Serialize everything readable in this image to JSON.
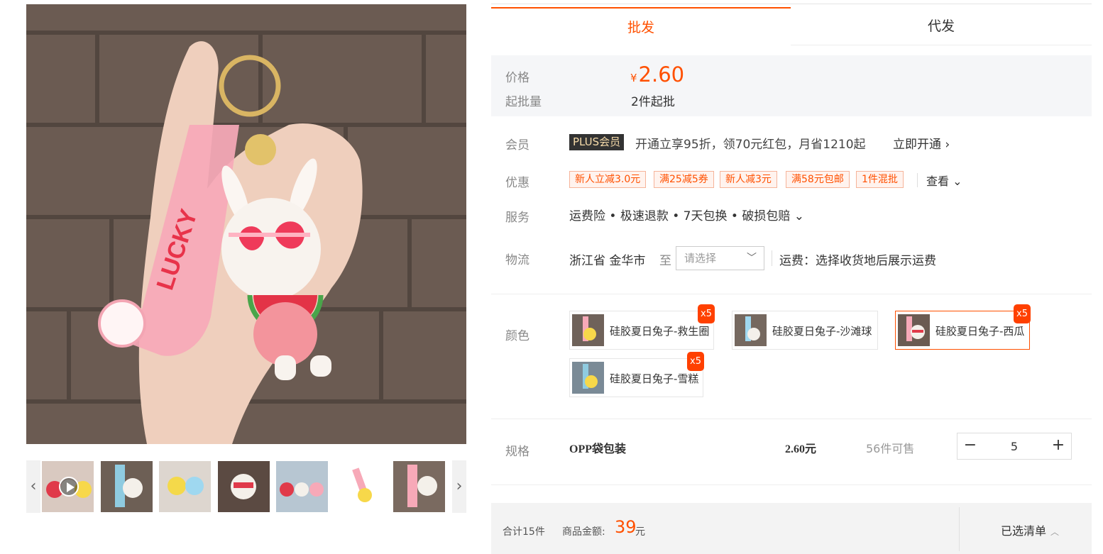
{
  "tabs": {
    "wholesale": "批发",
    "dropship": "代发"
  },
  "price": {
    "label": "价格",
    "currency": "¥",
    "value": "2.60",
    "moq_label": "起批量",
    "moq_value": "2件起批"
  },
  "member": {
    "label": "会员",
    "badge": "PLUS会员",
    "text": "开通立享95折，领70元红包，月省1210起",
    "link": "立即开通 ›"
  },
  "promo": {
    "label": "优惠",
    "coupons": [
      "新人立减3.0元",
      "满25减5券",
      "新人减3元",
      "满58元包邮",
      "1件混批"
    ],
    "view": "查看 ⌄"
  },
  "service": {
    "label": "服务",
    "text": "运费险 • 极速退款 • 7天包换 • 破损包赔 ⌄"
  },
  "logistics": {
    "label": "物流",
    "origin": "浙江省 金华市",
    "to": "至",
    "select_placeholder": "请选择",
    "fee": "运费：选择收货地后展示运费"
  },
  "color": {
    "label": "颜色",
    "options": [
      {
        "name": "硅胶夏日兔子-救生圈",
        "qty": "x5",
        "selected": false
      },
      {
        "name": "硅胶夏日兔子-沙滩球",
        "qty": "",
        "selected": false
      },
      {
        "name": "硅胶夏日兔子-西瓜",
        "qty": "x5",
        "selected": true
      },
      {
        "name": "硅胶夏日兔子-雪糕",
        "qty": "x5",
        "selected": false
      }
    ]
  },
  "spec": {
    "label": "规格",
    "name": "OPP袋包装",
    "price": "2.60元",
    "stock": "56件可售",
    "quantity": "5",
    "minus": "−",
    "plus": "+"
  },
  "summary": {
    "count": "合计15件",
    "amount_label": "商品金额:",
    "amount": "39",
    "unit": "元",
    "selected_list": "已选清单"
  },
  "colors": {
    "accent": "#ff5000",
    "panel_bg": "#f5f6f8"
  }
}
